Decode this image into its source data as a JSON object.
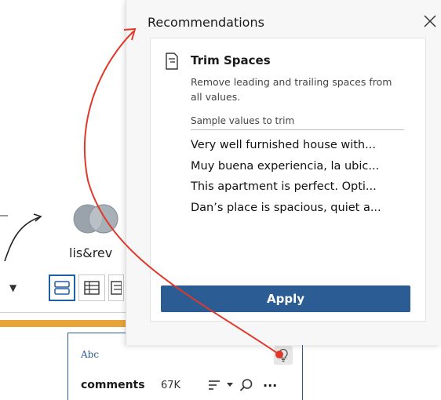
{
  "workspace": {
    "join_label": "lis&rev",
    "join_icon": "venn-join-icon",
    "dropdown_glyph": "▼"
  },
  "view_toolbar": {
    "icons": [
      "profile-view-icon",
      "table-view-icon",
      "list-view-icon"
    ],
    "active": "profile-view-icon"
  },
  "field_card": {
    "type_label": "Abc",
    "name": "comments",
    "count": "67K",
    "tool_icons": [
      "sort-icon",
      "chevron-down-icon",
      "search-icon",
      "more-icon"
    ],
    "more_glyph": "···",
    "recommendation_icon": "lightbulb-icon"
  },
  "panel": {
    "title": "Recommendations",
    "close_icon": "close-icon",
    "recommendation": {
      "icon": "trim-document-icon",
      "title": "Trim Spaces",
      "description": "Remove leading and trailing spaces from all values.",
      "sample_label": "Sample values to trim",
      "samples": [
        "Very well furnished house with...",
        "Muy buena experiencia, la ubic...",
        "This apartment is perfect. Opti...",
        "Dan’s place is spacious, quiet a..."
      ],
      "apply_label": "Apply"
    }
  },
  "colors": {
    "accent": "#2b5c93",
    "annotation_arrow": "#e0392b",
    "highlight_bar": "#e8a436",
    "panel_bg": "#f7f7f7"
  }
}
